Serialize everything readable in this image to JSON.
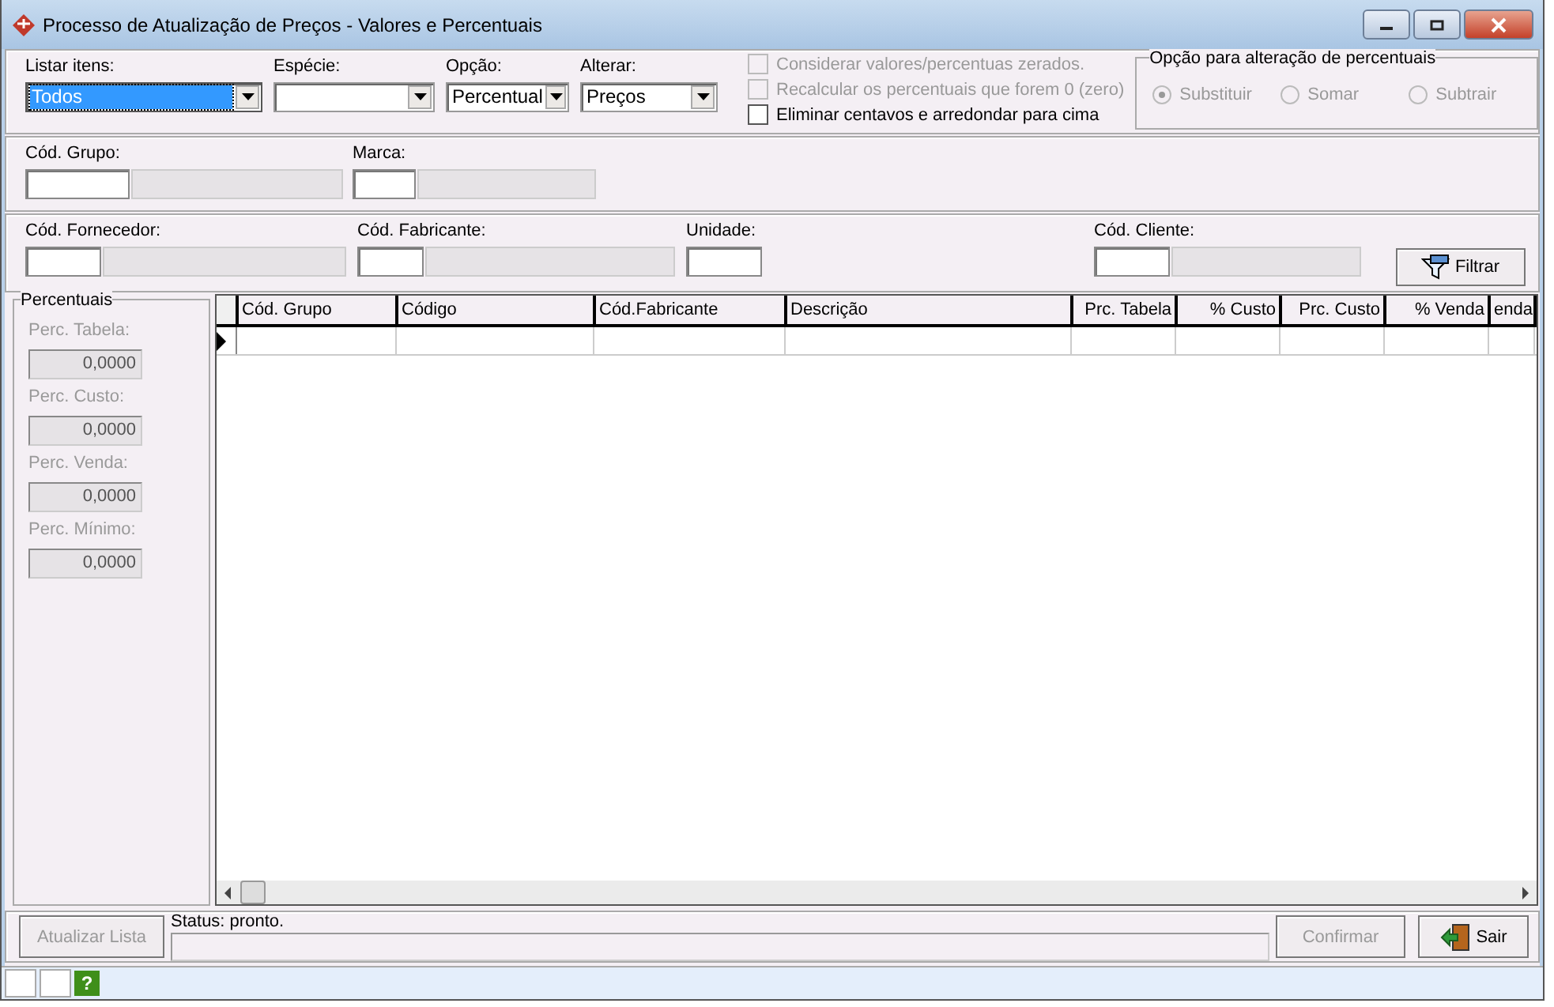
{
  "window": {
    "title": "Processo de Atualização de Preços - Valores e Percentuais"
  },
  "dropdowns": [
    {
      "label": "Listar itens:",
      "value": "Todos",
      "focused": true
    },
    {
      "label": "Espécie:",
      "focused": false
    },
    {
      "label": "Opção:",
      "value": "Percentual",
      "focused": false
    },
    {
      "label": "Alterar:",
      "value": "Preços",
      "focused": false
    }
  ],
  "checkboxes": [
    {
      "label": "Considerar valores/percentuas zerados.",
      "checked": false,
      "disabled": true
    },
    {
      "label": "Recalcular os percentuais que forem 0 (zero)",
      "checked": false,
      "disabled": true
    },
    {
      "label": "Eliminar centavos e arredondar para cima",
      "checked": false,
      "disabled": false
    }
  ],
  "radio_group": {
    "title": "Opção para alteração de percentuais",
    "options": [
      {
        "label": "Substituir",
        "selected": true,
        "disabled": true
      },
      {
        "label": "Somar",
        "selected": false,
        "disabled": true
      },
      {
        "label": "Subtrair",
        "selected": false,
        "disabled": true
      }
    ]
  },
  "lookup_row_1": [
    {
      "label": "Cód. Grupo:",
      "kind": "code_name"
    },
    {
      "label": "Marca:",
      "kind": "code_name"
    }
  ],
  "lookup_row_2": [
    {
      "label": "Cód. Fornecedor:",
      "kind": "code_name"
    },
    {
      "label": "Cód. Fabricante:",
      "kind": "code_name"
    },
    {
      "label": "Unidade:",
      "kind": "code"
    },
    {
      "label": "Cód. Cliente:",
      "kind": "code_name"
    }
  ],
  "filter_button": {
    "label": "Filtrar"
  },
  "percentuais": {
    "title": "Percentuais",
    "fields": [
      {
        "label": "Perc. Tabela:",
        "value": "0,0000",
        "disabled": true
      },
      {
        "label": "Perc. Custo:",
        "value": "0,0000",
        "disabled": true
      },
      {
        "label": "Perc. Venda:",
        "value": "0,0000",
        "disabled": true
      },
      {
        "label": "Perc. Mínimo:",
        "value": "0,0000",
        "disabled": true
      }
    ]
  },
  "grid": {
    "columns": [
      {
        "label": "Cód. Grupo"
      },
      {
        "label": "Código"
      },
      {
        "label": "Cód.Fabricante"
      },
      {
        "label": "Descrição"
      },
      {
        "label": "Prc. Tabela"
      },
      {
        "label": "% Custo"
      },
      {
        "label": "Prc. Custo"
      },
      {
        "label": "% Venda"
      },
      {
        "label": "enda"
      }
    ]
  },
  "status": {
    "label": "Status: pronto.",
    "level": 0
  },
  "buttons": [
    {
      "label": "Atualizar Lista",
      "disabled": true,
      "kind": "update"
    },
    {
      "label": "Confirmar",
      "disabled": true,
      "kind": "confirm"
    },
    {
      "label": "Sair",
      "disabled": false,
      "kind": "exit"
    }
  ],
  "status_bar": {
    "help": "?"
  }
}
